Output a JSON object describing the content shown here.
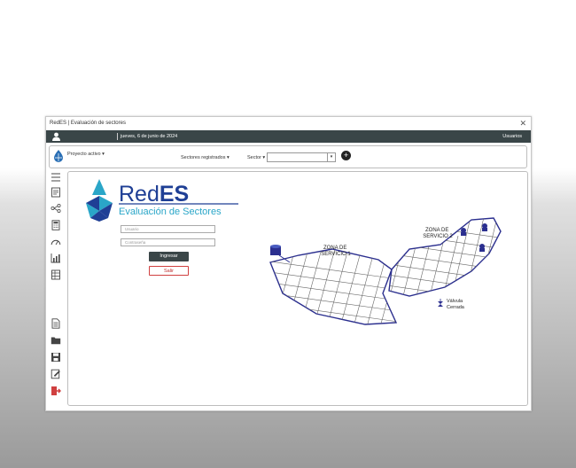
{
  "window": {
    "title": "RedES | Evaluación de sectores",
    "close": "✕"
  },
  "userbar": {
    "date": "jueves, 6 de junio de 2024",
    "users_label": "Usuarios"
  },
  "toolbar": {
    "project_label": "Proyecto activo ▾",
    "sectors_label": "Sectores registrados ▾",
    "sector_label": "Sector ▾",
    "sector_value": "",
    "dropdown_arrow": "▾",
    "add_label": "+"
  },
  "sidebar": {
    "icons": [
      "menu-icon",
      "report-icon",
      "network-icon",
      "calculator-icon",
      "gauge-icon",
      "chart-icon",
      "table-icon",
      "document-icon",
      "folder-icon",
      "save-icon",
      "edit-icon",
      "exit-icon"
    ]
  },
  "brand": {
    "name_red": "Red",
    "name_es": "ES",
    "subtitle": "Evaluación de Sectores"
  },
  "login": {
    "user_placeholder": "Usuario",
    "password_placeholder": "Contraseña",
    "login_label": "Ingresar",
    "exit_label": "Salir"
  },
  "diagram": {
    "zone1": [
      "ZONA DE",
      "SERVICIO 1"
    ],
    "zone2": [
      "ZONA DE",
      "SERVICIO 2"
    ],
    "valve": [
      "Válvula",
      "Cerrada"
    ]
  },
  "colors": {
    "accent_dark": "#3a4648",
    "brand_blue": "#1f3f95",
    "brand_teal": "#2aa6c8",
    "exit_red": "#d04040",
    "line_color": "#2b2f8f"
  }
}
